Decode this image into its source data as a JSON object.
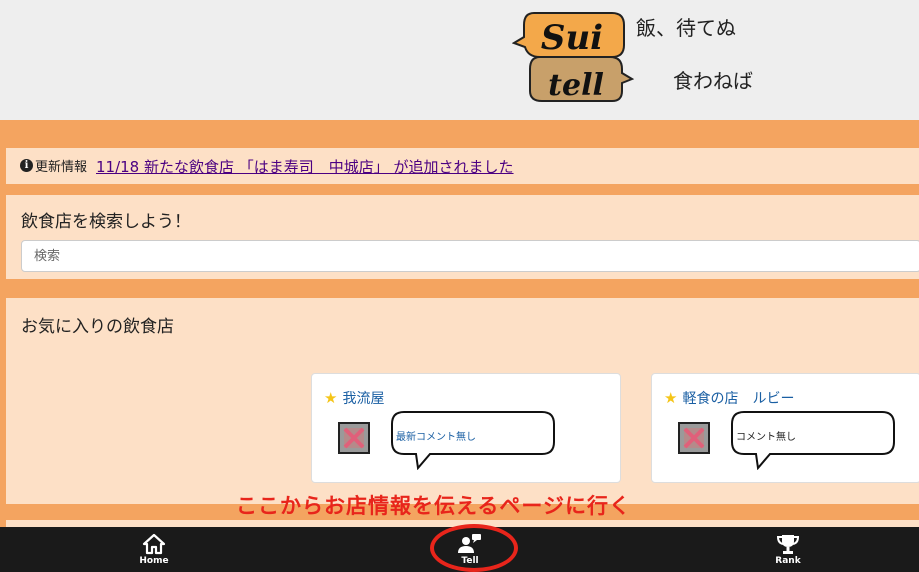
{
  "header": {
    "logo_text_top": "Sui",
    "logo_text_bottom": "tell",
    "tagline_line1": "飯、待てぬ",
    "tagline_line2": "食わねば"
  },
  "news": {
    "label": "更新情報",
    "link_text": "11/18 新たな飲食店 「はま寿司　中城店」 が追加されました"
  },
  "search": {
    "title": "飲食店を検索しよう！",
    "placeholder": "検索",
    "value": ""
  },
  "favorites": {
    "title": "お気に入りの飲食店",
    "cards": [
      {
        "name": "我流屋",
        "comment": "最新コメント無し",
        "comment_color": "#1a5fa3"
      },
      {
        "name": "軽食の店　ルビー",
        "comment": "コメント無し",
        "comment_color": "#222222"
      }
    ]
  },
  "annotation": {
    "text": "ここからお店情報を伝えるページに行く",
    "color": "#e8251b"
  },
  "tabbar": {
    "tabs": [
      {
        "label": "Home",
        "icon": "home-icon"
      },
      {
        "label": "Tell",
        "icon": "tell-icon"
      },
      {
        "label": "Rank",
        "icon": "trophy-icon"
      }
    ]
  },
  "colors": {
    "background": "#f4a460",
    "panel": "#fde0c6",
    "header": "#eeeeee",
    "tabbar": "#1a1a1a",
    "link": "#4b0082"
  }
}
